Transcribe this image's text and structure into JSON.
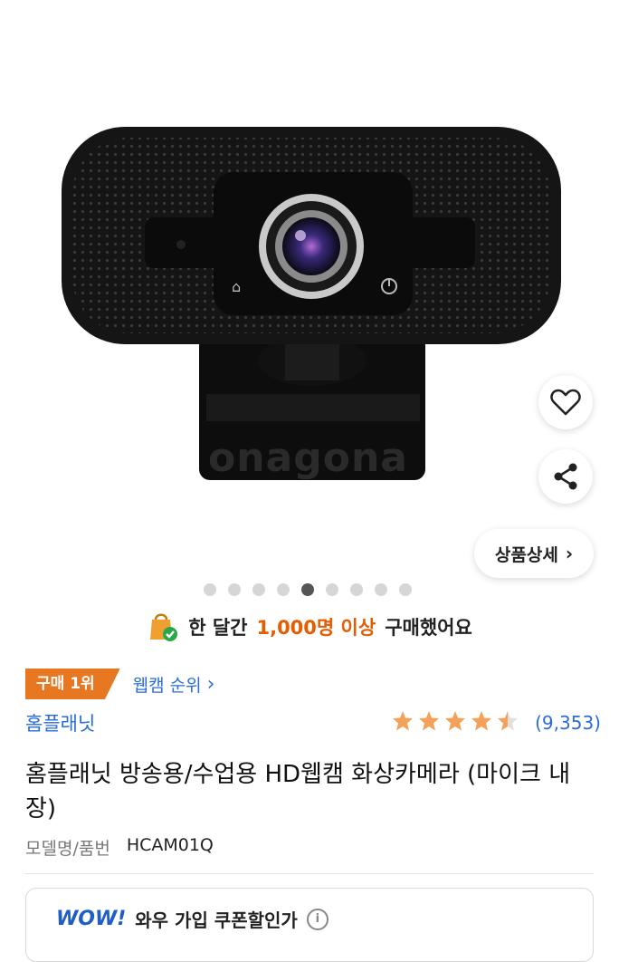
{
  "product_image": {
    "watermark": "onagona"
  },
  "actions": {
    "wishlist_icon": "heart-icon",
    "share_icon": "share-icon",
    "detail_label": "상품상세"
  },
  "carousel": {
    "total": 9,
    "active_index": 5
  },
  "purchase_info": {
    "prefix": "한 달간",
    "highlight": "1,000명 이상",
    "suffix": "구매했어요"
  },
  "rank": {
    "badge": "구매 1위",
    "link": "웹캠 순위"
  },
  "brand": "홈플래닛",
  "rating": {
    "stars": 4.5,
    "count": "(9,353)"
  },
  "title": "홈플래닛 방송용/수업용 HD웹캠 화상카메라 (마이크 내장)",
  "model": {
    "label": "모델명/품번",
    "value": "HCAM01Q"
  },
  "wow": {
    "logo": "WOW!",
    "text": "와우 가입 쿠폰할인가"
  },
  "colors": {
    "accent_orange": "#e87722",
    "link_blue": "#2a6dd6",
    "star": "#f4a259"
  }
}
